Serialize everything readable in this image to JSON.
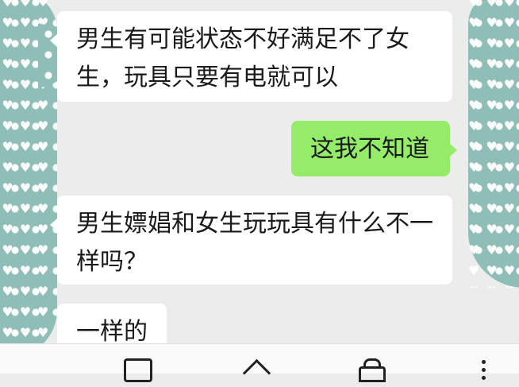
{
  "messages": [
    {
      "direction": "received",
      "text": "男生有可能状态不好满足不了女生，玩具只要有电就可以"
    },
    {
      "direction": "sent",
      "text": "这我不知道"
    },
    {
      "direction": "received",
      "text": "男生嫖娼和女生玩玩具有什么不一样吗？"
    },
    {
      "direction": "received",
      "text": "一样的"
    }
  ],
  "nav": {
    "icons": [
      "recent-apps-icon",
      "home-icon",
      "assistant-icon",
      "more-menu-icon"
    ]
  },
  "colors": {
    "background": "#ececec",
    "received_bubble": "#ffffff",
    "sent_bubble": "#95ec69",
    "avatar_pattern": "#8fbdb7"
  }
}
